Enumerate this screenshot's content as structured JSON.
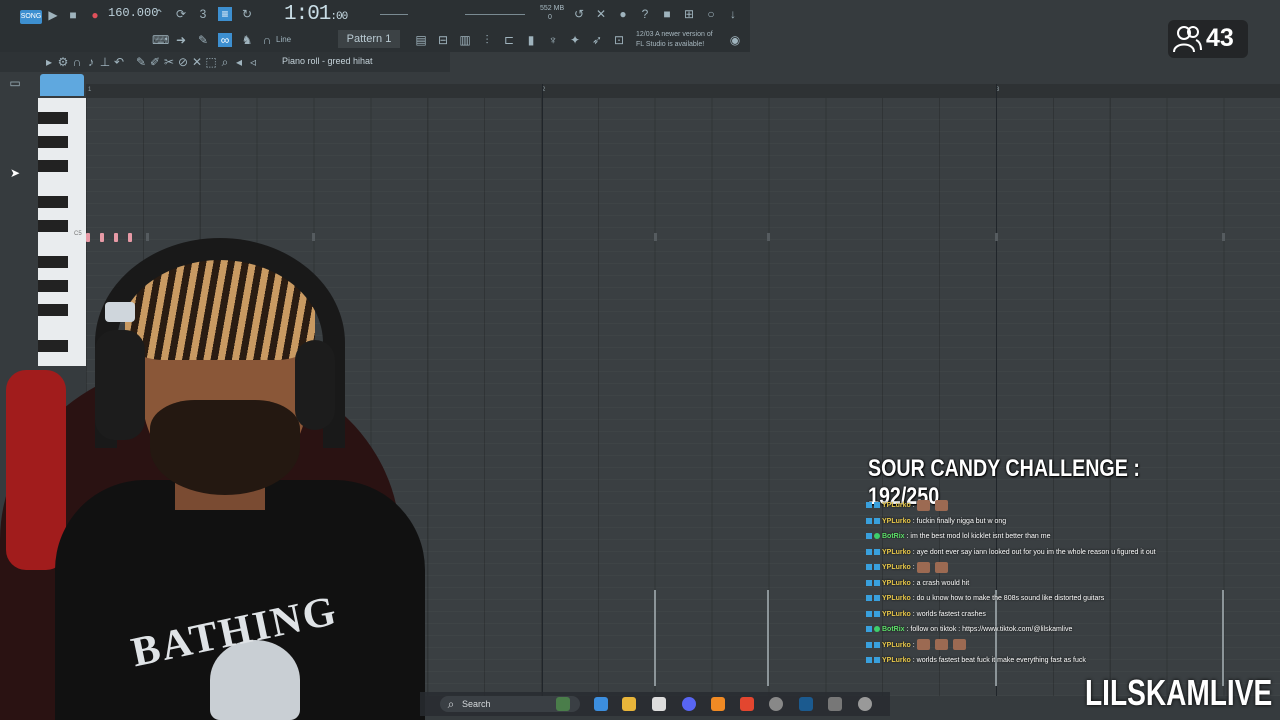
{
  "toolbar": {
    "song_label": "SONG",
    "tempo": "160.000",
    "time": "1:01",
    "time_small": ":00",
    "memory": "552 MB",
    "memory_sub": "0",
    "snap_label": "Line",
    "pattern": "Pattern 1",
    "update_date": "12/03",
    "update_line1": "A newer version of",
    "update_line2": "FL Studio is available!"
  },
  "piano_roll": {
    "title": "Piano roll - greed hihat",
    "ruler": [
      "1",
      "2",
      "3"
    ],
    "key_label": "C5"
  },
  "viewers": {
    "count": "43"
  },
  "overlay": {
    "challenge": "SOUR CANDY CHALLENGE : 192/250",
    "brand": "LILSKAMLIVE",
    "shirt_text": "BATHING"
  },
  "chat": [
    {
      "user": "YPLurko",
      "text": "",
      "emotes": 2,
      "badge": "blue"
    },
    {
      "user": "YPLurko",
      "text": "fuckin finally nigga but w ong",
      "emotes": 0,
      "badge": "blue"
    },
    {
      "user": "BotRix",
      "text": "im the best mod lol kicklet isnt better than me",
      "emotes": 0,
      "badge": "green"
    },
    {
      "user": "YPLurko",
      "text": "aye dont ever say iann looked out for you im the whole reason u figured it out",
      "emotes": 0,
      "badge": "blue"
    },
    {
      "user": "YPLurko",
      "text": "",
      "emotes": 2,
      "badge": "blue"
    },
    {
      "user": "YPLurko",
      "text": "a crash would hit",
      "emotes": 0,
      "badge": "blue"
    },
    {
      "user": "YPLurko",
      "text": "do u know how to make the 808s sound like distorted guitars",
      "emotes": 0,
      "badge": "blue"
    },
    {
      "user": "YPLurko",
      "text": "worlds fastest crashes",
      "emotes": 0,
      "badge": "blue"
    },
    {
      "user": "BotRix",
      "text": "follow on tiktok : https://www.tiktok.com/@lilskamlive",
      "emotes": 0,
      "badge": "green"
    },
    {
      "user": "YPLurko",
      "text": "",
      "emotes": 3,
      "badge": "blue"
    },
    {
      "user": "YPLurko",
      "text": "worlds fastest beat fuck it make everything fast as fuck",
      "emotes": 0,
      "badge": "blue"
    }
  ],
  "taskbar": {
    "search_label": "Search"
  }
}
